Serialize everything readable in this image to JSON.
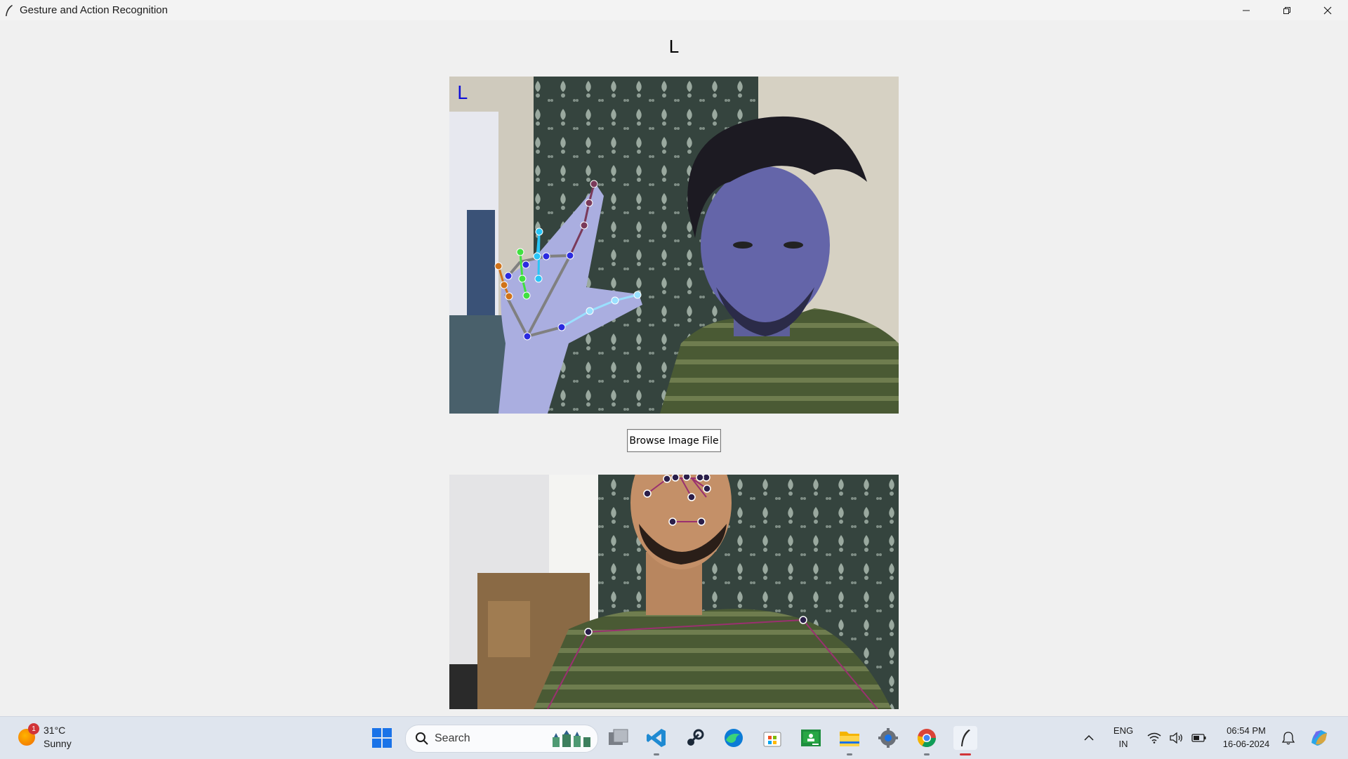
{
  "window": {
    "title": "Gesture and Action Recognition",
    "controls": [
      "minimize-icon",
      "restore-icon",
      "close-icon"
    ]
  },
  "main": {
    "gesture_result": "L",
    "feed1_overlay_text": "L",
    "browse_button_label": "Browse Image File"
  },
  "taskbar": {
    "weather": {
      "temperature": "31°C",
      "condition": "Sunny",
      "badge": "1"
    },
    "search_placeholder": "Search",
    "apps": [
      "windows-start-icon",
      "search-icon",
      "task-view-icon",
      "vscode-icon",
      "steam-icon",
      "edge-icon",
      "microsoft-store-icon",
      "classroom-icon",
      "file-explorer-icon",
      "settings-icon",
      "chrome-icon",
      "python-tk-app-icon"
    ],
    "tray": {
      "language_line1": "ENG",
      "language_line2": "IN",
      "time": "06:54 PM",
      "date": "16-06-2024"
    }
  },
  "colors": {
    "window_bg": "#f0f0f0",
    "taskbar_bg": "#dfe5ee",
    "overlay_text": "#1010d8"
  }
}
